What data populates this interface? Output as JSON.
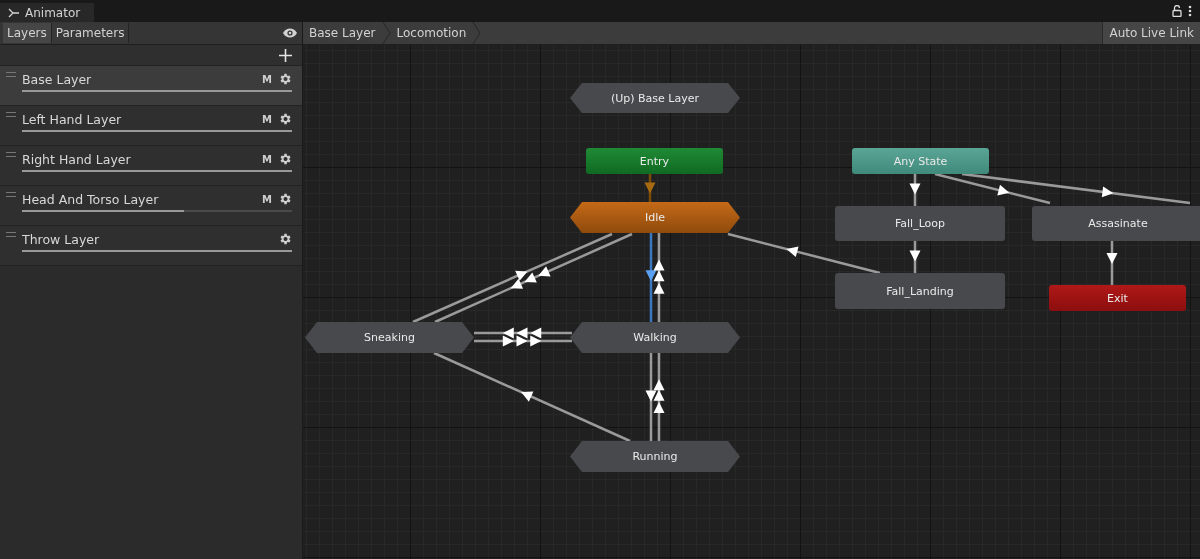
{
  "window": {
    "title": "Animator"
  },
  "left_panel": {
    "tabs": [
      {
        "label": "Layers",
        "selected": true
      },
      {
        "label": "Parameters",
        "selected": false
      }
    ],
    "layers": [
      {
        "name": "Base Layer",
        "selected": true,
        "mask": "M",
        "level": 1
      },
      {
        "name": "Left Hand Layer",
        "selected": false,
        "mask": "M",
        "level": 1
      },
      {
        "name": "Right Hand Layer",
        "selected": false,
        "mask": "M",
        "level": 1
      },
      {
        "name": "Head And Torso Layer",
        "selected": false,
        "mask": "M",
        "level": 0.6
      },
      {
        "name": "Throw Layer",
        "selected": false,
        "level": 1
      }
    ]
  },
  "breadcrumb": [
    {
      "label": "Base Layer"
    },
    {
      "label": "Locomotion"
    }
  ],
  "auto_live_link": {
    "label": "Auto Live Link"
  },
  "graph": {
    "nodes": [
      {
        "label": "(Up) Base Layer",
        "kind": "machine",
        "default": false
      },
      {
        "label": "Entry",
        "kind": "entry"
      },
      {
        "label": "Any State",
        "kind": "any"
      },
      {
        "label": "Idle",
        "kind": "machine",
        "default": true
      },
      {
        "label": "Fall_Loop",
        "kind": "state",
        "default": false
      },
      {
        "label": "Assasinate",
        "kind": "state",
        "default": false
      },
      {
        "label": "Fall_Landing",
        "kind": "state",
        "default": false
      },
      {
        "label": "Exit",
        "kind": "exit"
      },
      {
        "label": "Sneaking",
        "kind": "machine",
        "default": false
      },
      {
        "label": "Walking",
        "kind": "machine",
        "default": false
      },
      {
        "label": "Running",
        "kind": "machine",
        "default": false
      }
    ]
  }
}
